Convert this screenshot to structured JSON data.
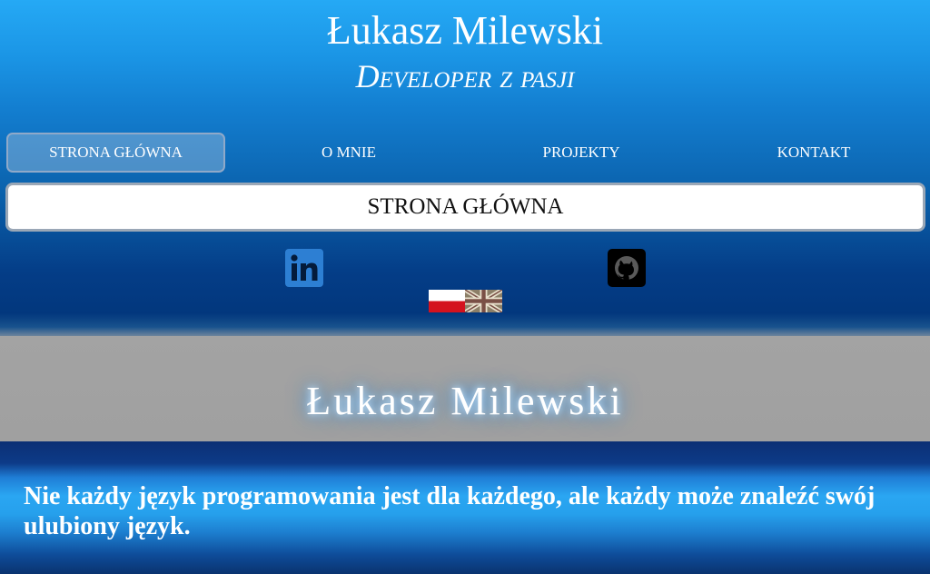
{
  "header": {
    "title": "Łukasz Milewski",
    "subtitle": "Developer z pasji"
  },
  "nav": {
    "items": [
      {
        "label": "Strona Główna",
        "active": true
      },
      {
        "label": "O mnie",
        "active": false
      },
      {
        "label": "Projekty",
        "active": false
      },
      {
        "label": "Kontakt",
        "active": false
      }
    ]
  },
  "current_page": "STRONA GŁÓWNA",
  "social": {
    "links": [
      {
        "icon": "linkedin-icon",
        "color": "#2d7fd3"
      },
      {
        "icon": "github-icon",
        "color": "#000000"
      }
    ]
  },
  "languages": {
    "flags": [
      {
        "icon": "polish-flag-icon"
      },
      {
        "icon": "british-flag-icon"
      }
    ]
  },
  "hero": {
    "title": "Łukasz Milewski"
  },
  "quote": "Nie każdy język programowania jest dla każdego, ale każdy może znaleźć swój ulubiony język."
}
